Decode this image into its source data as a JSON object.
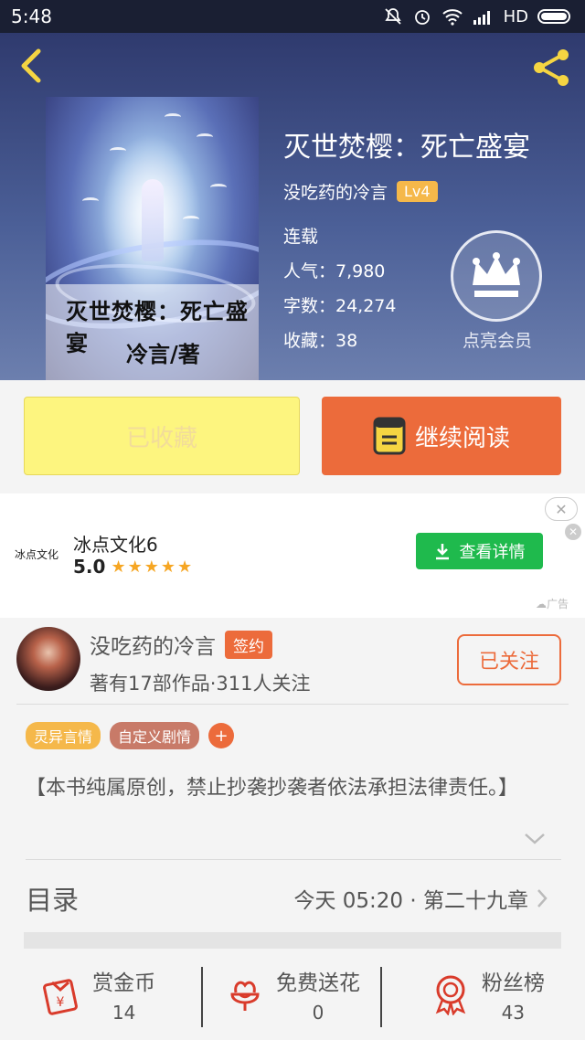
{
  "status_bar": {
    "time": "5:48",
    "network": "HD"
  },
  "book": {
    "title": "灭世焚樱：死亡盛宴",
    "author": "没吃药的冷言",
    "level": "Lv4",
    "status": "连载",
    "popularity": "人气：7,980",
    "word_count": "字数：24,274",
    "favorites": "收藏：38",
    "cover_title": "灭世焚樱：死亡盛宴",
    "cover_author": "冷言/著"
  },
  "vip": {
    "label": "点亮会员"
  },
  "actions": {
    "collected_label": "已收藏",
    "read_label": "继续阅读"
  },
  "ad": {
    "logo_text": "冰点文化",
    "name": "冰点文化6",
    "rating": "5.0",
    "stars": "★★★★★",
    "button_label": "查看详情",
    "tag": "广告"
  },
  "author_section": {
    "name": "没吃药的冷言",
    "badge": "签约",
    "stats": "著有17部作品·311人关注",
    "follow_label": "已关注"
  },
  "tags": [
    {
      "label": "灵异言情",
      "color": "#f5b84a"
    },
    {
      "label": "自定义剧情",
      "color": "#c87a68"
    }
  ],
  "synopsis": "【本书纯属原创，禁止抄袭抄袭者依法承担法律责任。】",
  "toc": {
    "label": "目录",
    "latest": "今天 05:20 · 第二十九章"
  },
  "bottom": [
    {
      "label": "赏金币",
      "count": "14",
      "icon": "coin-envelope-icon"
    },
    {
      "label": "免费送花",
      "count": "0",
      "icon": "flower-icon"
    },
    {
      "label": "粉丝榜",
      "count": "43",
      "icon": "medal-icon"
    }
  ],
  "colors": {
    "accent": "#ec6b3b",
    "gold": "#f5b84a",
    "collected_bg": "#fdf57f",
    "ad_green": "#1fba4d"
  }
}
